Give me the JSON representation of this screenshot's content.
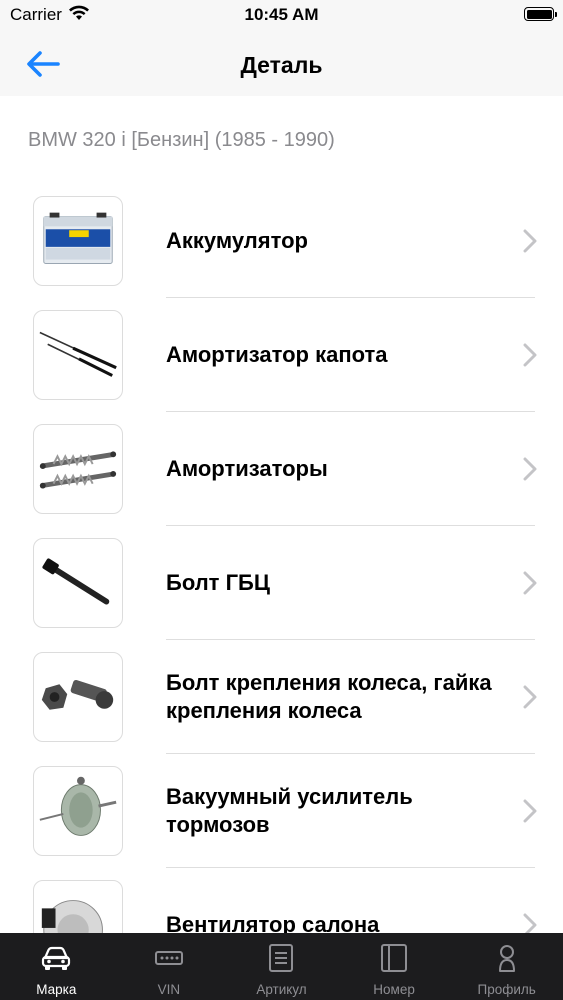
{
  "status_bar": {
    "carrier": "Carrier",
    "time": "10:45 AM"
  },
  "navbar": {
    "title": "Деталь",
    "back_icon": "arrow-left-icon"
  },
  "vehicle": "BMW 320 i [Бензин] (1985 - 1990)",
  "parts": [
    {
      "label": "Аккумулятор",
      "image": "battery"
    },
    {
      "label": "Амортизатор капота",
      "image": "hood-struts"
    },
    {
      "label": "Амортизаторы",
      "image": "shock-absorbers"
    },
    {
      "label": "Болт ГБЦ",
      "image": "head-bolt"
    },
    {
      "label": "Болт крепления колеса, гайка крепления колеса",
      "image": "wheel-bolt-nut"
    },
    {
      "label": "Вакуумный усилитель тормозов",
      "image": "brake-booster"
    },
    {
      "label": "Вентилятор салона",
      "image": "cabin-fan"
    }
  ],
  "tabs": [
    {
      "label": "Марка",
      "icon": "car-icon",
      "active": true
    },
    {
      "label": "VIN",
      "icon": "vin-card-icon",
      "active": false
    },
    {
      "label": "Артикул",
      "icon": "document-icon",
      "active": false
    },
    {
      "label": "Номер",
      "icon": "panel-icon",
      "active": false
    },
    {
      "label": "Профиль",
      "icon": "person-icon",
      "active": false
    }
  ],
  "colors": {
    "accent": "#1a84ff",
    "tabbar_bg": "#1c1c1e",
    "chevron": "#c4c4c7",
    "subtitle": "#8a8a8e"
  }
}
